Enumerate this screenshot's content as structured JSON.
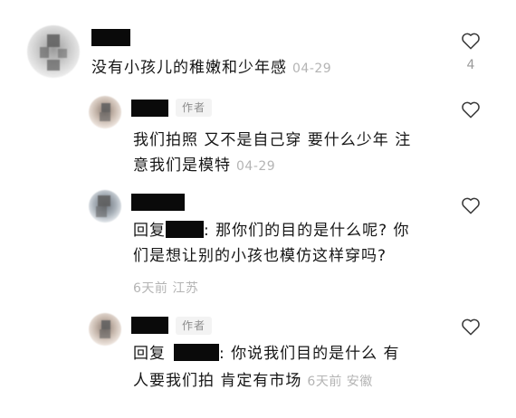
{
  "comments": [
    {
      "text": "没有小孩儿的稚嫩和少年感",
      "time": "04-29",
      "likes": "4"
    },
    {
      "badge": "作者",
      "line1": "我们拍照 又不是自己穿 要什么少年 注",
      "line2": "意我们是模特",
      "time": "04-29"
    },
    {
      "reply_prefix": "回复",
      "line1_suffix": ": 那你们的目的是什么呢? 你",
      "line2": "们是想让别的小孩也模仿这样穿吗?",
      "meta": "6天前 江苏"
    },
    {
      "badge": "作者",
      "reply_prefix": "回复",
      "line1_suffix": ": 你说我们目的是什么 有",
      "line2": "人要我们拍 肯定有市场",
      "meta": "6天前 安徽"
    }
  ],
  "icons": {
    "like": "heart-outline-icon"
  },
  "colors": {
    "text": "#161616",
    "meta": "#b4b4b4",
    "badge_bg": "#f3f3f3",
    "redaction": "#0a0a0a"
  }
}
